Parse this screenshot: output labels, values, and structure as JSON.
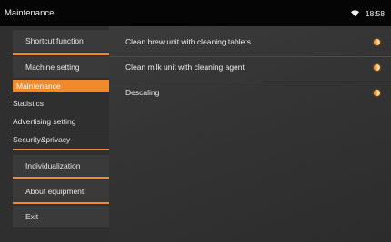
{
  "topbar": {
    "title": "Maintenance",
    "time": "18:58",
    "wifi_icon": "wifi-icon"
  },
  "sidebar": {
    "shortcut": "Shortcut function",
    "machine_setting": "Machine setting",
    "maintenance": "Maintenance",
    "statistics": "Statistics",
    "advertising": "Advertising setting",
    "security": "Security&privacy",
    "individualization": "Individualization",
    "about": "About equipment",
    "exit": "Exit"
  },
  "main": {
    "items": [
      {
        "label": "Clean brew unit with cleaning tablets"
      },
      {
        "label": "Clean milk unit with cleaning agent"
      },
      {
        "label": "Descaling"
      }
    ]
  },
  "colors": {
    "accent": "#f08a2c",
    "topbar": "#050505",
    "sidebar": "#2f2f2f"
  }
}
